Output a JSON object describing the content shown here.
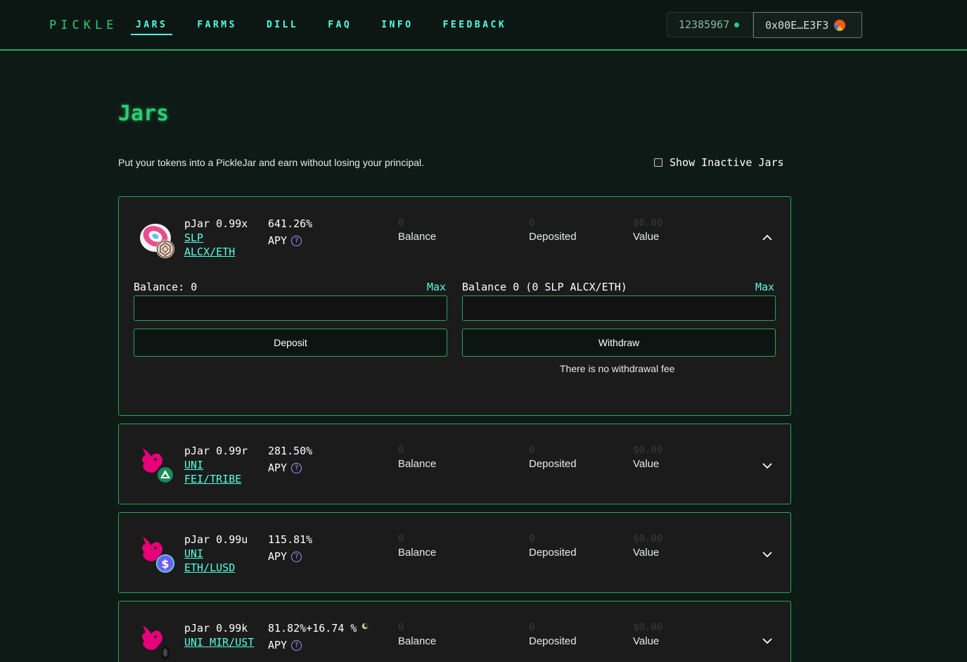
{
  "header": {
    "logo": "PICKLE",
    "nav": [
      "JARS",
      "FARMS",
      "DILL",
      "FAQ",
      "INFO",
      "FEEDBACK"
    ],
    "active_nav": "JARS",
    "block_number": "12385967",
    "wallet_address": "0x00E…E3F3"
  },
  "page": {
    "title": "Jars",
    "subtitle": "Put your tokens into a PickleJar and earn without losing your principal.",
    "show_inactive_label": "Show Inactive Jars",
    "show_inactive_checked": false
  },
  "jars": [
    {
      "name": "pJar 0.99x",
      "protocol": "SLP",
      "pair": "ALCX/ETH",
      "apy": "641.26%",
      "apy_label": "APY",
      "balance": "0",
      "balance_label": "Balance",
      "deposited": "0",
      "deposited_label": "Deposited",
      "value": "$0.00",
      "value_label": "Value",
      "expanded": true,
      "icon": "sushi-alcx-icon"
    },
    {
      "name": "pJar 0.99r",
      "protocol": "UNI",
      "pair": "FEI/TRIBE",
      "apy": "281.50%",
      "apy_label": "APY",
      "balance": "0",
      "balance_label": "Balance",
      "deposited": "0",
      "deposited_label": "Deposited",
      "value": "$0.00",
      "value_label": "Value",
      "expanded": false,
      "icon": "uniswap-tribe-icon"
    },
    {
      "name": "pJar 0.99u",
      "protocol": "UNI",
      "pair": "ETH/LUSD",
      "apy": "115.81%",
      "apy_label": "APY",
      "balance": "0",
      "balance_label": "Balance",
      "deposited": "0",
      "deposited_label": "Deposited",
      "value": "$0.00",
      "value_label": "Value",
      "expanded": false,
      "icon": "uniswap-lusd-icon"
    },
    {
      "name": "pJar 0.99k",
      "protocol_pair": "UNI MIR/UST",
      "apy": "81.82%+16.74 %",
      "apy_label": "APY",
      "balance": "0",
      "balance_label": "Balance",
      "deposited": "0",
      "deposited_label": "Deposited",
      "value": "$0.00",
      "value_label": "Value",
      "expanded": false,
      "icon": "uniswap-mir-icon"
    }
  ],
  "expanded_panel": {
    "deposit_balance_label": "Balance: 0",
    "withdraw_balance_label": "Balance 0 (0 SLP ALCX/ETH)",
    "max_label": "Max",
    "deposit_value": "",
    "withdraw_value": "",
    "deposit_button": "Deposit",
    "withdraw_button": "Withdraw",
    "fee_note": "There is no withdrawal fee"
  },
  "colors": {
    "accent_green": "#2ecc71",
    "accent_cyan": "#53ffe2",
    "border_green": "#26a65b",
    "background": "#0e1a16",
    "card": "#1b1b1b"
  }
}
